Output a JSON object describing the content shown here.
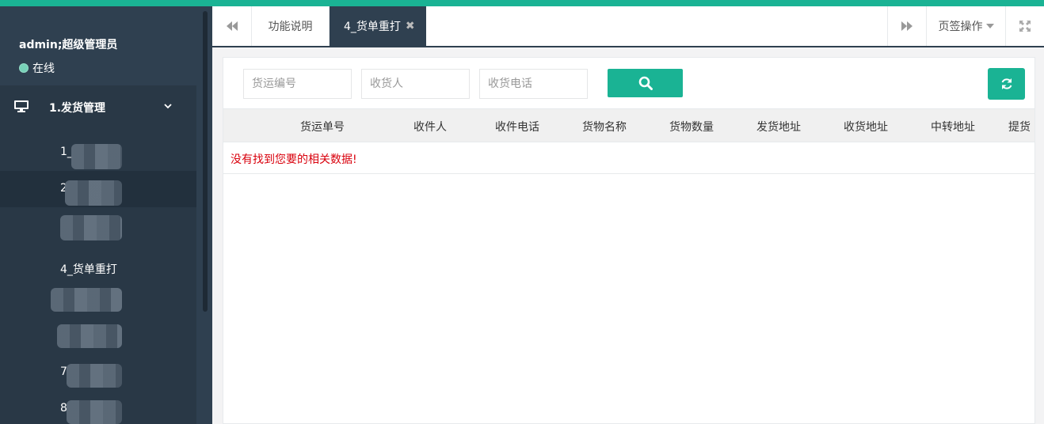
{
  "user": {
    "name": "admin;超级管理员",
    "status": "在线"
  },
  "menu": {
    "parent_label": "1.发货管理",
    "items": [
      {
        "label": "1_"
      },
      {
        "label": "2"
      },
      {
        "label": ""
      },
      {
        "label": "4_货单重打"
      },
      {
        "label": ""
      },
      {
        "label": ""
      },
      {
        "label": "7"
      },
      {
        "label": "8"
      }
    ]
  },
  "tabs": {
    "items": [
      {
        "label": "功能说明"
      },
      {
        "label": "4_货单重打"
      }
    ],
    "page_ops_label": "页签操作"
  },
  "search": {
    "tracking_placeholder": "货运编号",
    "receiver_placeholder": "收货人",
    "phone_placeholder": "收货电话"
  },
  "table": {
    "columns": [
      "货运单号",
      "收件人",
      "收件电话",
      "货物名称",
      "货物数量",
      "发货地址",
      "收货地址",
      "中转地址",
      "提货"
    ],
    "empty_message": "没有找到您要的相关数据!"
  },
  "icons": {
    "nav_back": "double-chevron-left-icon",
    "nav_forward": "double-chevron-right-icon",
    "tab_close": "close-icon",
    "fullscreen": "expand-icon",
    "search": "search-icon",
    "refresh": "refresh-icon",
    "menu": "monitor-icon"
  },
  "colors": {
    "accent": "#1ab394",
    "sidebar": "#2f4050",
    "error_text": "#d9000c"
  }
}
